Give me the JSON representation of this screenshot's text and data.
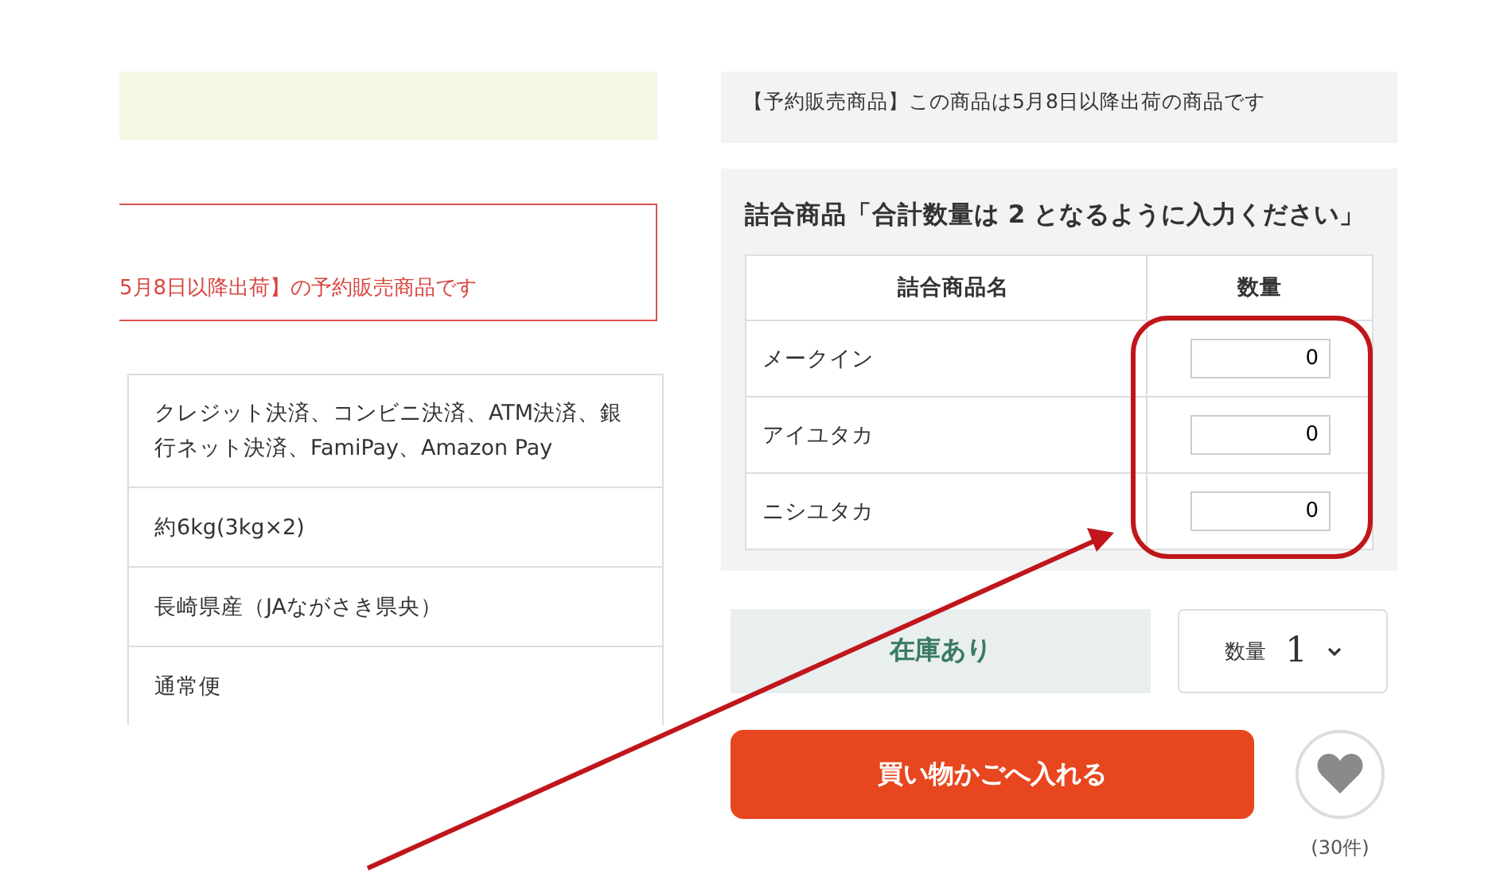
{
  "reservation_notice": {
    "text": "5月8日以降出荷】の予約販売商品です"
  },
  "spec_rows": [
    {
      "value": "クレジット決済、コンビニ決済、ATM決済、銀行ネット決済、FamiPay、Amazon Pay"
    },
    {
      "value": "約6kg(3kg×2)"
    },
    {
      "value": "長崎県産（JAながさき県央）"
    },
    {
      "value": "通常便"
    }
  ],
  "shipping_note": {
    "text": "【予約販売商品】この商品は5月8日以降出荷の商品です"
  },
  "assortment": {
    "title": "詰合商品「合計数量は 2 となるように入力ください」",
    "columns": [
      "詰合商品名",
      "数量"
    ],
    "rows": [
      {
        "name": "メークイン",
        "quantity": "0"
      },
      {
        "name": "アイユタカ",
        "quantity": "0"
      },
      {
        "name": "ニシユタカ",
        "quantity": "0"
      }
    ]
  },
  "stock": {
    "label": "在庫あり"
  },
  "quantity": {
    "label": "数量",
    "value": "1"
  },
  "cart_button": {
    "label": "買い物かごへ入れる"
  },
  "favorite": {
    "count": "(30件)"
  }
}
